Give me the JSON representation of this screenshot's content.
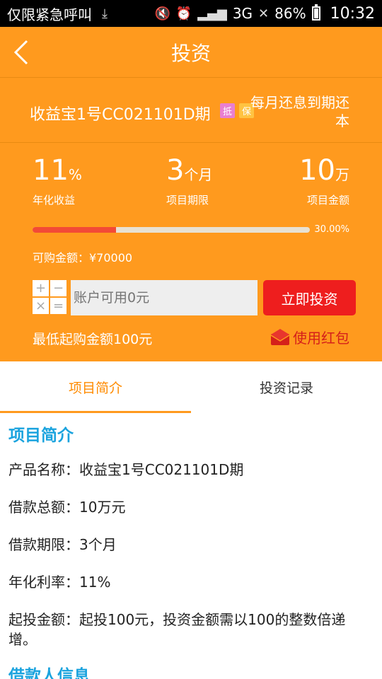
{
  "status_bar": {
    "left_text": "仅限紧急呼叫",
    "signal_text": "3G",
    "battery": "86%",
    "time": "10:32",
    "battery_level": 0.86
  },
  "header": {
    "title": "投资",
    "back_icon": "chevron-left-icon"
  },
  "product": {
    "name": "收益宝1号CC021101D期",
    "tags": [
      "抵",
      "保"
    ],
    "repayment": "每月还息到期还本"
  },
  "stats": {
    "rate": {
      "value": "11",
      "unit": "%",
      "label": "年化收益"
    },
    "term": {
      "value": "3",
      "unit": "个月",
      "label": "项目期限"
    },
    "amount": {
      "value": "10",
      "unit": "万",
      "label": "项目金额"
    }
  },
  "progress": {
    "percent_text": "30.00%",
    "fraction": 0.3
  },
  "buyable": "可购金额：¥70000",
  "calc_keys": [
    "+",
    "−",
    "×",
    "="
  ],
  "amount_input": {
    "placeholder": "账户可用0元",
    "value": ""
  },
  "invest_button": "立即投资",
  "min_buy": "最低起购金额100元",
  "red_packet": "使用红包",
  "tabs": [
    {
      "label": "项目简介",
      "active": true
    },
    {
      "label": "投资记录",
      "active": false
    }
  ],
  "intro": {
    "title": "项目简介",
    "lines": [
      "产品名称：收益宝1号CC021101D期",
      "借款总额：10万元",
      "借款期限：3个月",
      "年化利率：11%",
      "起投金额：起投100元，投资金额需以100的整数倍递增。"
    ]
  },
  "borrower": {
    "title": "借款人信息"
  },
  "colors": {
    "header_bg": "#ff9a1e",
    "progress_fill": "#f34a36",
    "invest_button": "#ee1e1e",
    "tab_active": "#ff8b00",
    "section_title": "#1aa3de"
  }
}
